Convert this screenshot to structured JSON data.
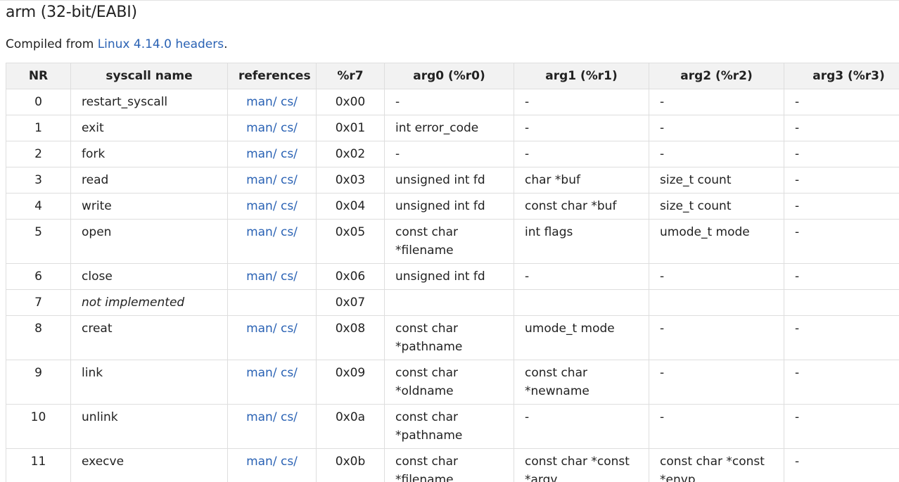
{
  "title": "arm (32-bit/EABI)",
  "compiled": {
    "prefix": "Compiled from ",
    "link_text": "Linux 4.14.0 headers",
    "suffix": "."
  },
  "table": {
    "headers": [
      "NR",
      "syscall name",
      "references",
      "%r7",
      "arg0 (%r0)",
      "arg1 (%r1)",
      "arg2 (%r2)",
      "arg3 (%r3)"
    ],
    "rows": [
      {
        "nr": "0",
        "name": "restart_syscall",
        "man": "man/",
        "cs": "cs/",
        "reg": "0x00",
        "arg0": "-",
        "arg1": "-",
        "arg2": "-",
        "arg3": "-"
      },
      {
        "nr": "1",
        "name": "exit",
        "man": "man/",
        "cs": "cs/",
        "reg": "0x01",
        "arg0": "int error_code",
        "arg1": "-",
        "arg2": "-",
        "arg3": "-"
      },
      {
        "nr": "2",
        "name": "fork",
        "man": "man/",
        "cs": "cs/",
        "reg": "0x02",
        "arg0": "-",
        "arg1": "-",
        "arg2": "-",
        "arg3": "-"
      },
      {
        "nr": "3",
        "name": "read",
        "man": "man/",
        "cs": "cs/",
        "reg": "0x03",
        "arg0": "unsigned int fd",
        "arg1": "char *buf",
        "arg2": "size_t count",
        "arg3": "-"
      },
      {
        "nr": "4",
        "name": "write",
        "man": "man/",
        "cs": "cs/",
        "reg": "0x04",
        "arg0": "unsigned int fd",
        "arg1": "const char *buf",
        "arg2": "size_t count",
        "arg3": "-"
      },
      {
        "nr": "5",
        "name": "open",
        "man": "man/",
        "cs": "cs/",
        "reg": "0x05",
        "arg0": "const char *filename",
        "arg1": "int flags",
        "arg2": "umode_t mode",
        "arg3": "-"
      },
      {
        "nr": "6",
        "name": "close",
        "man": "man/",
        "cs": "cs/",
        "reg": "0x06",
        "arg0": "unsigned int fd",
        "arg1": "-",
        "arg2": "-",
        "arg3": "-"
      },
      {
        "nr": "7",
        "name": "not implemented",
        "not_implemented": true,
        "man": "",
        "cs": "",
        "reg": "0x07",
        "arg0": "",
        "arg1": "",
        "arg2": "",
        "arg3": ""
      },
      {
        "nr": "8",
        "name": "creat",
        "man": "man/",
        "cs": "cs/",
        "reg": "0x08",
        "arg0": "const char *pathname",
        "arg1": "umode_t mode",
        "arg2": "-",
        "arg3": "-"
      },
      {
        "nr": "9",
        "name": "link",
        "man": "man/",
        "cs": "cs/",
        "reg": "0x09",
        "arg0": "const char *oldname",
        "arg1": "const char *newname",
        "arg2": "-",
        "arg3": "-"
      },
      {
        "nr": "10",
        "name": "unlink",
        "man": "man/",
        "cs": "cs/",
        "reg": "0x0a",
        "arg0": "const char *pathname",
        "arg1": "-",
        "arg2": "-",
        "arg3": "-"
      },
      {
        "nr": "11",
        "name": "execve",
        "man": "man/",
        "cs": "cs/",
        "reg": "0x0b",
        "arg0": "const char *filename",
        "arg1": "const char *const *argv",
        "arg2": "const char *const *envp",
        "arg3": "-"
      }
    ]
  },
  "colors": {
    "link": "#2a62b4",
    "header_bg": "#f2f2f2",
    "border": "#dedede"
  }
}
